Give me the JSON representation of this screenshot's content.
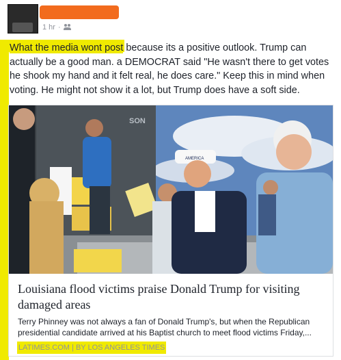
{
  "post": {
    "timestamp": "1 hr",
    "separator": "·",
    "privacy_icon": "friends-icon",
    "highlighted_text": "What the media wont post",
    "body_text": " because its a positive outlook. Trump can actually be a good man. a DEMOCRAT said \"He wasn't there to get votes he shook my hand and it felt real, he does care.\" Keep this in mind when voting. He might not show it a lot, but Trump does have a soft side."
  },
  "link_card": {
    "title": "Louisiana flood victims praise Donald Trump for visiting damaged areas",
    "description": "Terry Phinney was not always a fan of Donald Trump's, but when the Republican presidential candidate arrived at his Baptist church to meet flood victims Friday,...",
    "source": "LATIMES.COM | BY LOS ANGELES TIMES",
    "photo_truck_text": "SON",
    "photo_hat_text": "AMERICA"
  },
  "colors": {
    "highlight": "#f0ea00",
    "redaction": "#f26b1d",
    "meta_gray": "#90949c",
    "text": "#1d2129"
  }
}
